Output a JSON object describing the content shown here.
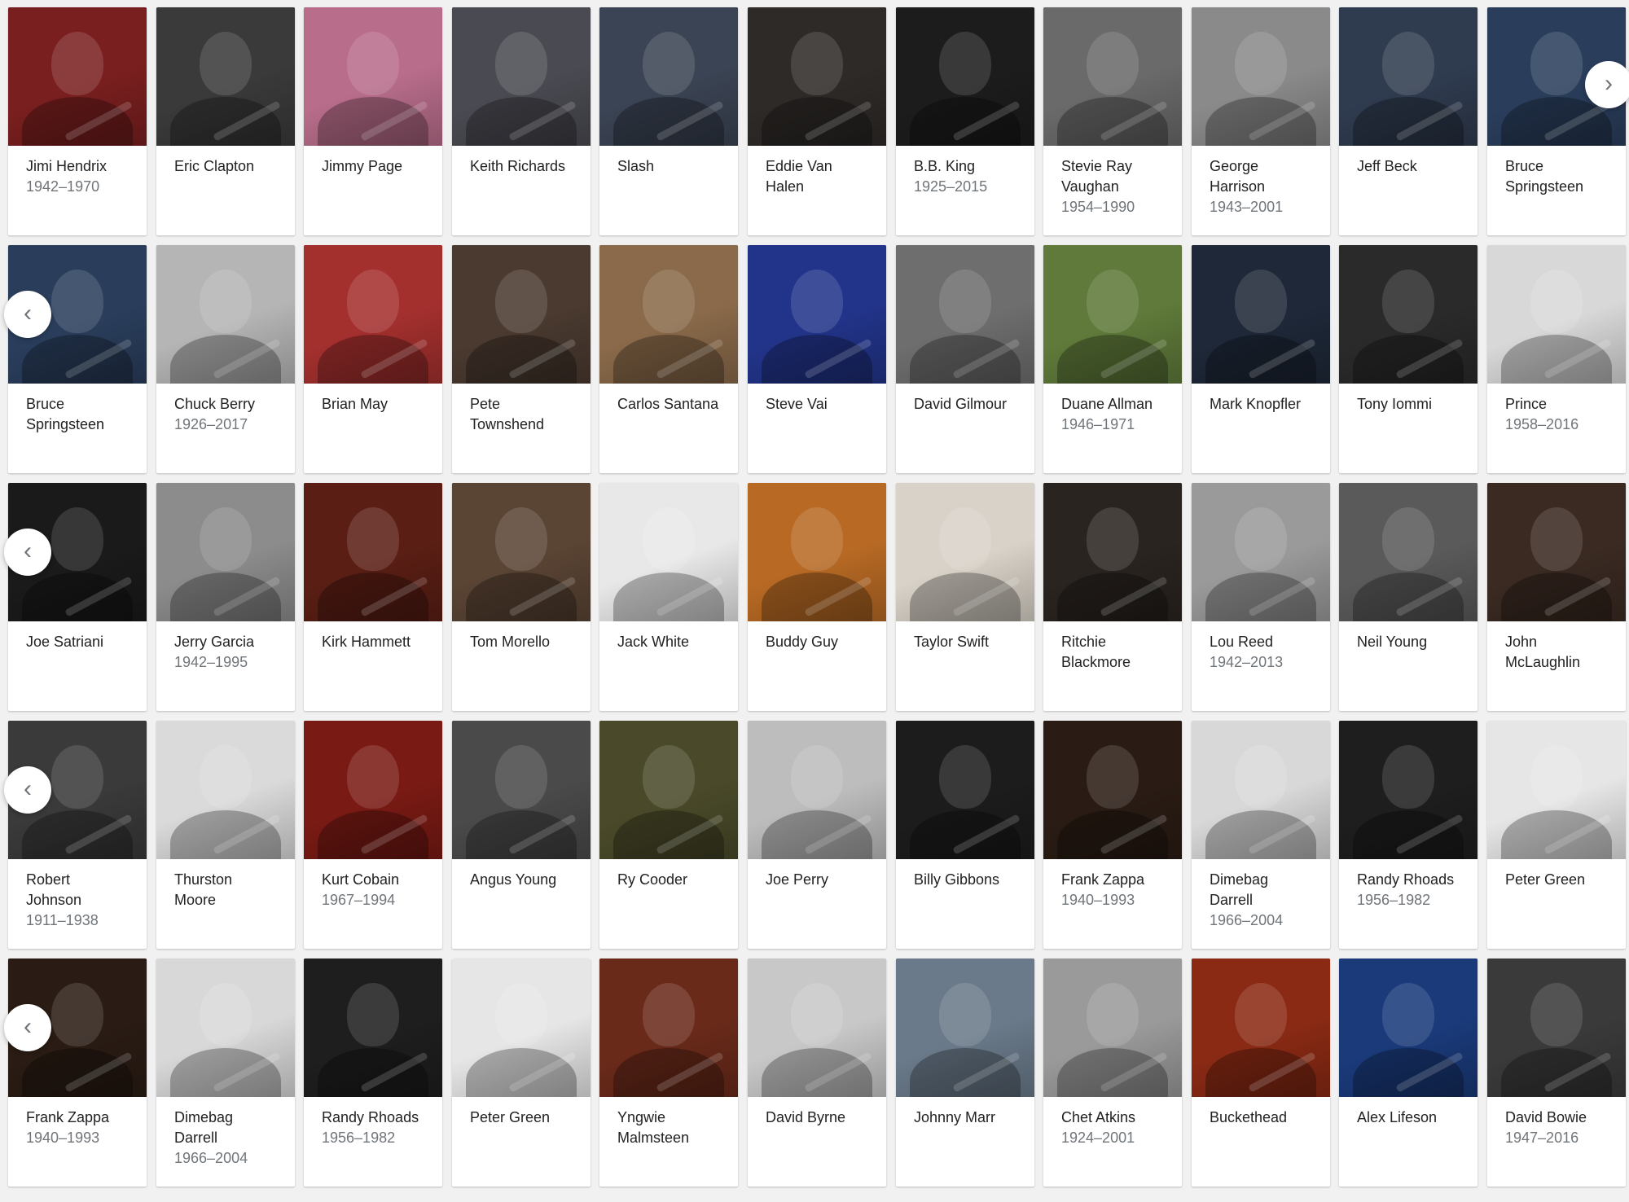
{
  "colors": {
    "page_background": "#f1f1f1",
    "card_background": "#ffffff",
    "name_text": "#222222",
    "years_text": "#70757a"
  },
  "carousels": [
    {
      "nav": {
        "prev": false,
        "next": true,
        "prev_icon": "chevron-left-icon",
        "next_icon": "chevron-right-icon"
      },
      "items": [
        {
          "name": "Jimi Hendrix",
          "years": "1942–1970",
          "bg": "#7a1f1f"
        },
        {
          "name": "Eric Clapton",
          "years": "",
          "bg": "#3a3a3a"
        },
        {
          "name": "Jimmy Page",
          "years": "",
          "bg": "#b86d8a"
        },
        {
          "name": "Keith Richards",
          "years": "",
          "bg": "#4a4a52"
        },
        {
          "name": "Slash",
          "years": "",
          "bg": "#3b4454"
        },
        {
          "name": "Eddie Van Halen",
          "years": "",
          "bg": "#2e2a28"
        },
        {
          "name": "B.B. King",
          "years": "1925–2015",
          "bg": "#1c1c1c"
        },
        {
          "name": "Stevie Ray Vaughan",
          "years": "1954–1990",
          "bg": "#6a6a6a"
        },
        {
          "name": "George Harrison",
          "years": "1943–2001",
          "bg": "#8a8a8a"
        },
        {
          "name": "Jeff Beck",
          "years": "",
          "bg": "#2f3b4f"
        },
        {
          "name": "Bruce Springsteen",
          "years": "",
          "bg": "#2a3e5c"
        }
      ]
    },
    {
      "nav": {
        "prev": true,
        "next": false,
        "prev_icon": "chevron-left-icon",
        "next_icon": "chevron-right-icon"
      },
      "items": [
        {
          "name": "Bruce Springsteen",
          "years": "",
          "bg": "#2a3e5c"
        },
        {
          "name": "Chuck Berry",
          "years": "1926–2017",
          "bg": "#b5b5b5"
        },
        {
          "name": "Brian May",
          "years": "",
          "bg": "#a4302e"
        },
        {
          "name": "Pete Townshend",
          "years": "",
          "bg": "#4a3a30"
        },
        {
          "name": "Carlos Santana",
          "years": "",
          "bg": "#8a6a4a"
        },
        {
          "name": "Steve Vai",
          "years": "",
          "bg": "#22348a"
        },
        {
          "name": "David Gilmour",
          "years": "",
          "bg": "#6e6e6e"
        },
        {
          "name": "Duane Allman",
          "years": "1946–1971",
          "bg": "#5f7a3a"
        },
        {
          "name": "Mark Knopfler",
          "years": "",
          "bg": "#1e2838"
        },
        {
          "name": "Tony Iommi",
          "years": "",
          "bg": "#2a2a2a"
        },
        {
          "name": "Prince",
          "years": "1958–2016",
          "bg": "#d8d8d8"
        }
      ]
    },
    {
      "nav": {
        "prev": true,
        "next": false,
        "prev_icon": "chevron-left-icon",
        "next_icon": "chevron-right-icon"
      },
      "items": [
        {
          "name": "Joe Satriani",
          "years": "",
          "bg": "#1a1a1a"
        },
        {
          "name": "Jerry Garcia",
          "years": "1942–1995",
          "bg": "#8c8c8c"
        },
        {
          "name": "Kirk Hammett",
          "years": "",
          "bg": "#5a1e14"
        },
        {
          "name": "Tom Morello",
          "years": "",
          "bg": "#5a4434"
        },
        {
          "name": "Jack White",
          "years": "",
          "bg": "#e8e8e8"
        },
        {
          "name": "Buddy Guy",
          "years": "",
          "bg": "#b86a24"
        },
        {
          "name": "Taylor Swift",
          "years": "",
          "bg": "#d9d2c8"
        },
        {
          "name": "Ritchie Blackmore",
          "years": "",
          "bg": "#2a2420"
        },
        {
          "name": "Lou Reed",
          "years": "1942–2013",
          "bg": "#9a9a9a"
        },
        {
          "name": "Neil Young",
          "years": "",
          "bg": "#5a5a5a"
        },
        {
          "name": "John McLaughlin",
          "years": "",
          "bg": "#3a2a22"
        }
      ]
    },
    {
      "nav": {
        "prev": true,
        "next": false,
        "prev_icon": "chevron-left-icon",
        "next_icon": "chevron-right-icon"
      },
      "items": [
        {
          "name": "Robert Johnson",
          "years": "1911–1938",
          "bg": "#3a3a3a"
        },
        {
          "name": "Thurston Moore",
          "years": "",
          "bg": "#dadada"
        },
        {
          "name": "Kurt Cobain",
          "years": "1967–1994",
          "bg": "#7a1a14"
        },
        {
          "name": "Angus Young",
          "years": "",
          "bg": "#4a4a4a"
        },
        {
          "name": "Ry Cooder",
          "years": "",
          "bg": "#4a4a2a"
        },
        {
          "name": "Joe Perry",
          "years": "",
          "bg": "#bdbdbd"
        },
        {
          "name": "Billy Gibbons",
          "years": "",
          "bg": "#1c1c1c"
        },
        {
          "name": "Frank Zappa",
          "years": "1940–1993",
          "bg": "#2a1c14"
        },
        {
          "name": "Dimebag Darrell",
          "years": "1966–2004",
          "bg": "#d8d8d8"
        },
        {
          "name": "Randy Rhoads",
          "years": "1956–1982",
          "bg": "#1e1e1e"
        },
        {
          "name": "Peter Green",
          "years": "",
          "bg": "#e6e6e6"
        }
      ]
    },
    {
      "nav": {
        "prev": true,
        "next": false,
        "prev_icon": "chevron-left-icon",
        "next_icon": "chevron-right-icon"
      },
      "items": [
        {
          "name": "Frank Zappa",
          "years": "1940–1993",
          "bg": "#2a1c14"
        },
        {
          "name": "Dimebag Darrell",
          "years": "1966–2004",
          "bg": "#d8d8d8"
        },
        {
          "name": "Randy Rhoads",
          "years": "1956–1982",
          "bg": "#1e1e1e"
        },
        {
          "name": "Peter Green",
          "years": "",
          "bg": "#e6e6e6"
        },
        {
          "name": "Yngwie Malmsteen",
          "years": "",
          "bg": "#6a2a1a"
        },
        {
          "name": "David Byrne",
          "years": "",
          "bg": "#c8c8c8"
        },
        {
          "name": "Johnny Marr",
          "years": "",
          "bg": "#6a7a8a"
        },
        {
          "name": "Chet Atkins",
          "years": "1924–2001",
          "bg": "#9a9a9a"
        },
        {
          "name": "Buckethead",
          "years": "",
          "bg": "#8a2a14"
        },
        {
          "name": "Alex Lifeson",
          "years": "",
          "bg": "#1a3a7a"
        },
        {
          "name": "David Bowie",
          "years": "1947–2016",
          "bg": "#3a3a3a"
        }
      ]
    }
  ]
}
